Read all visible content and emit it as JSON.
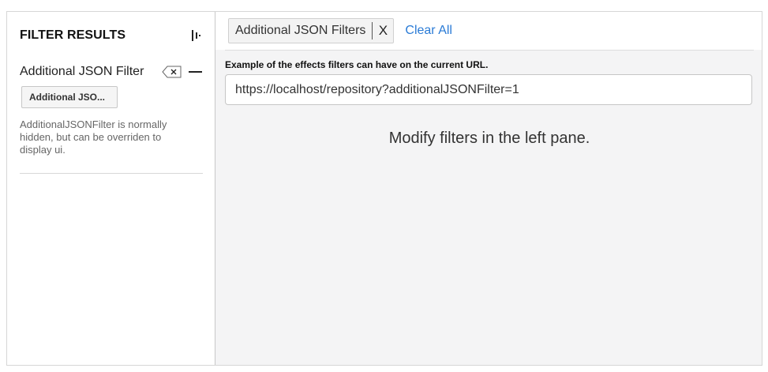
{
  "sidebar": {
    "title": "FILTER RESULTS",
    "filter": {
      "name": "Additional JSON Filter",
      "chip_label": "Additional JSO...",
      "description": "AdditionalJSONFilter is normally hidden, but can be overriden to display ui."
    }
  },
  "toolbar": {
    "active_filters": [
      {
        "label": "Additional JSON Filters",
        "remove_label": "X"
      }
    ],
    "clear_all_label": "Clear All"
  },
  "main": {
    "url_label": "Example of the effects filters can have on the current URL.",
    "url_value": "https://localhost/repository?additionalJSONFilter=1",
    "empty_message": "Modify filters in the left pane."
  },
  "colors": {
    "link": "#2a7bd6",
    "pane_background": "#f4f4f5"
  },
  "icons": [
    "collapse-panel-icon",
    "clear-filter-icon",
    "collapse-section-icon"
  ]
}
